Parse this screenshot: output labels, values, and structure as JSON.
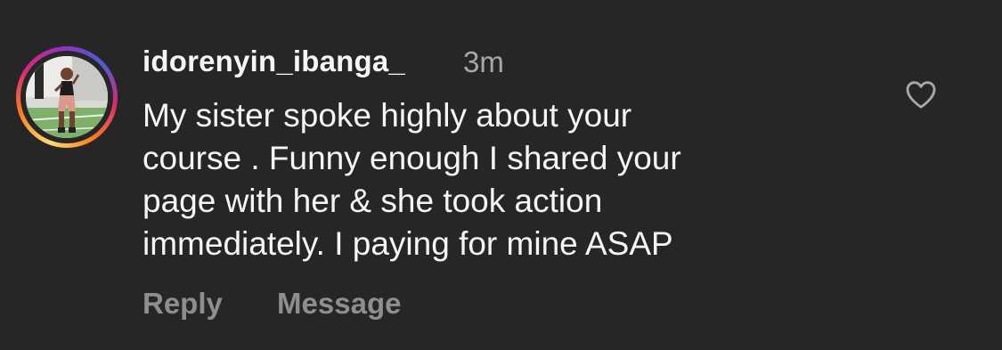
{
  "comment": {
    "username": "idorenyin_ibanga_",
    "timestamp": "3m",
    "text": "My sister spoke highly about your\ncourse . Funny enough I shared your\npage with her & she took action\nimmediately. I paying for mine ASAP",
    "avatar_icon": "profile-photo",
    "like_icon": "heart-outline-icon"
  },
  "actions": {
    "reply_label": "Reply",
    "message_label": "Message"
  },
  "colors": {
    "background": "#262626",
    "primary_text": "#f5f5f5",
    "secondary_text": "#a8a8a8",
    "action_text": "#8e8e8e"
  }
}
